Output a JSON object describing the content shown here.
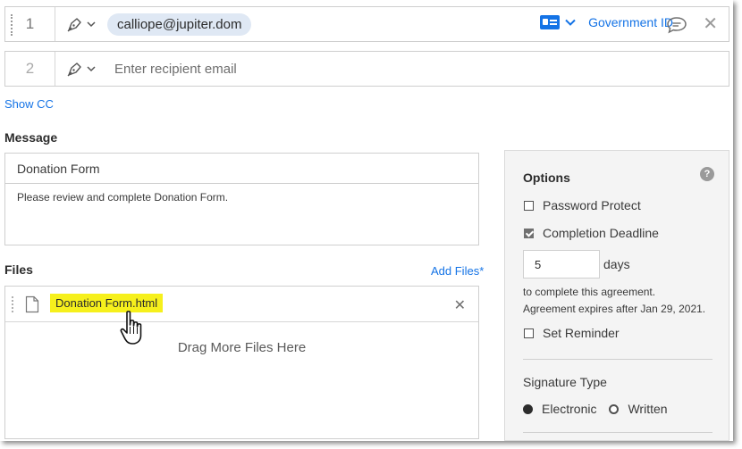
{
  "recipients": [
    {
      "number": "1",
      "email": "calliope@jupiter.dom",
      "auth_label": "Government ID"
    },
    {
      "number": "2",
      "placeholder": "Enter recipient email"
    }
  ],
  "show_cc": "Show CC",
  "message": {
    "label": "Message",
    "title": "Donation Form",
    "body": "Please review and complete Donation Form."
  },
  "files": {
    "label": "Files",
    "add_files": "Add Files*",
    "items": [
      {
        "name": "Donation Form.html"
      }
    ],
    "drop_hint": "Drag More Files Here"
  },
  "options": {
    "title": "Options",
    "help": "?",
    "password_protect": "Password Protect",
    "completion_deadline": "Completion Deadline",
    "days_value": "5",
    "days_unit": "days",
    "deadline_note": "to complete this agreement.",
    "expiry_note": "Agreement expires after Jan 29, 2021.",
    "set_reminder": "Set Reminder",
    "signature_type_label": "Signature Type",
    "signature_types": [
      "Electronic",
      "Written"
    ]
  },
  "colors": {
    "accent": "#1473e6",
    "highlight": "#f6f01c",
    "chip": "#dfe8f4"
  }
}
